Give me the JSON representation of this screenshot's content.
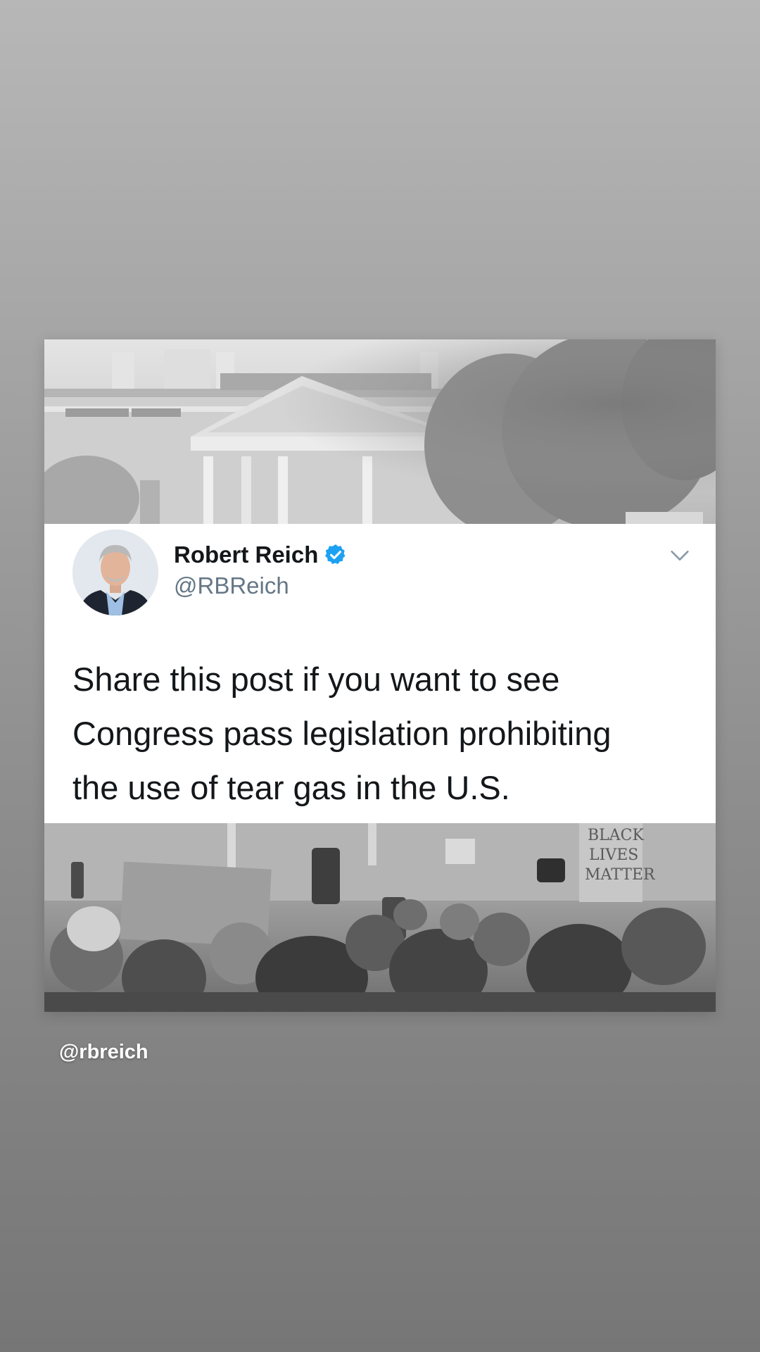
{
  "tweet": {
    "author_name": "Robert Reich",
    "handle": "@RBReich",
    "text": "Share this post if you want to see\nCongress pass legislation prohibiting\nthe use of tear gas in the U.S.",
    "verified_icon": "verified-badge-icon",
    "menu_icon": "chevron-down-icon",
    "colors": {
      "verified": "#1da1f2",
      "name": "#14171a",
      "handle": "#657786"
    }
  },
  "photo_bottom": {
    "sign_text": "BLACK\nLIVES\nMATTER"
  },
  "story": {
    "mention": "@rbreich"
  }
}
